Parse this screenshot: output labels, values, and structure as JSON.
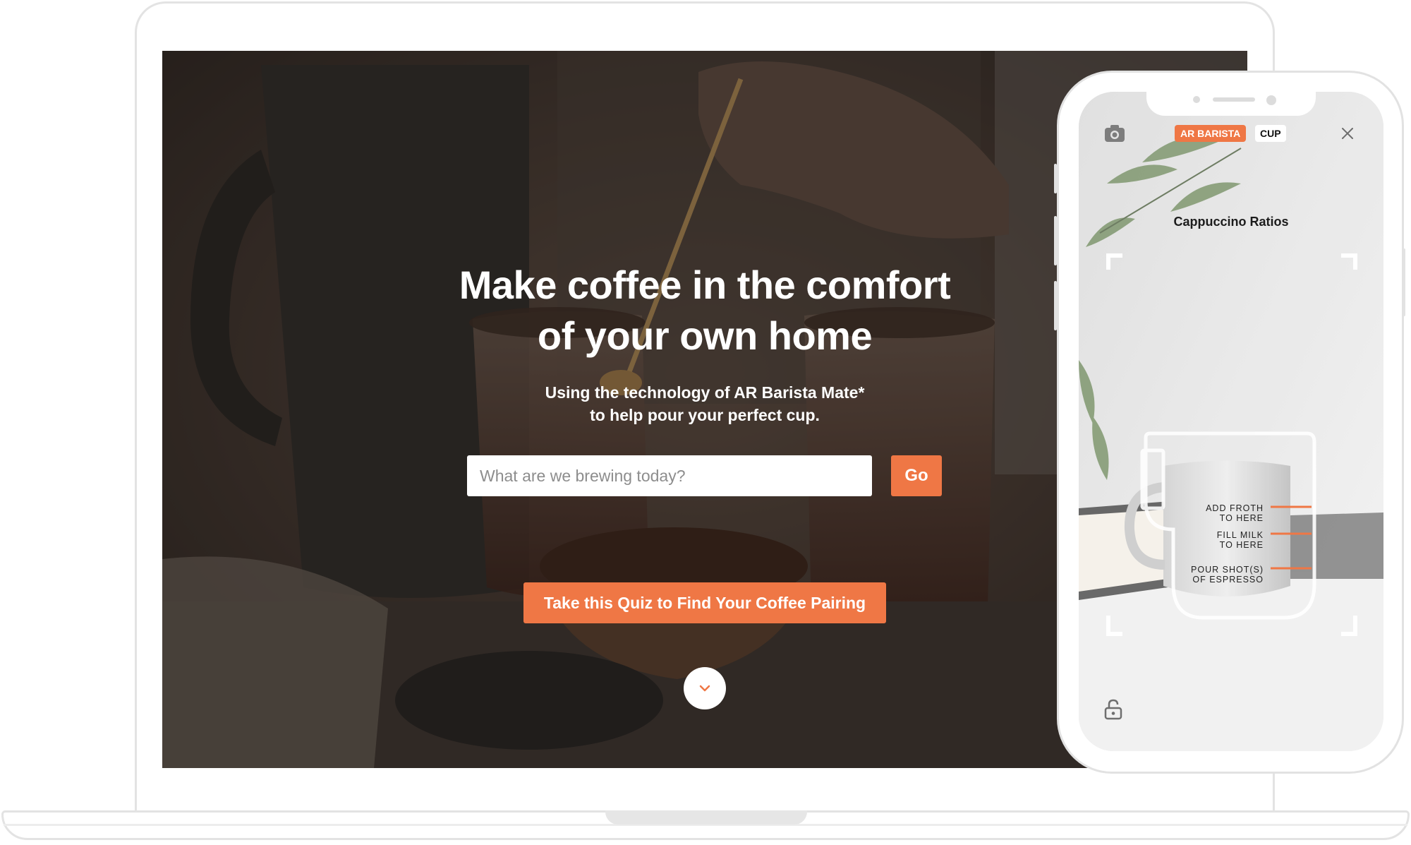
{
  "hero": {
    "title_line1": "Make coffee in the comfort",
    "title_line2": "of your own home",
    "subtitle_line1": "Using the technology of AR Barista Mate*",
    "subtitle_line2": "to help pour your perfect cup.",
    "search_placeholder": "What are we brewing today?",
    "go_label": "Go",
    "quiz_label": "Take this Quiz to Find Your Coffee Pairing",
    "scroll_icon": "chevron-down-icon"
  },
  "phone": {
    "badge_mode": "AR BARISTA",
    "badge_type": "CUP",
    "title": "Cappuccino Ratios",
    "labels": [
      {
        "line1": "ADD FROTH",
        "line2": "TO HERE"
      },
      {
        "line1": "FILL MILK",
        "line2": "TO HERE"
      },
      {
        "line1": "POUR SHOT(S)",
        "line2": "OF ESPRESSO"
      }
    ],
    "icons": [
      "camera-icon",
      "close-icon",
      "lock-icon"
    ]
  },
  "colors": {
    "accent": "#ef7745",
    "overlay_dark": "#2b2521",
    "frame": "#e3e3e3"
  }
}
